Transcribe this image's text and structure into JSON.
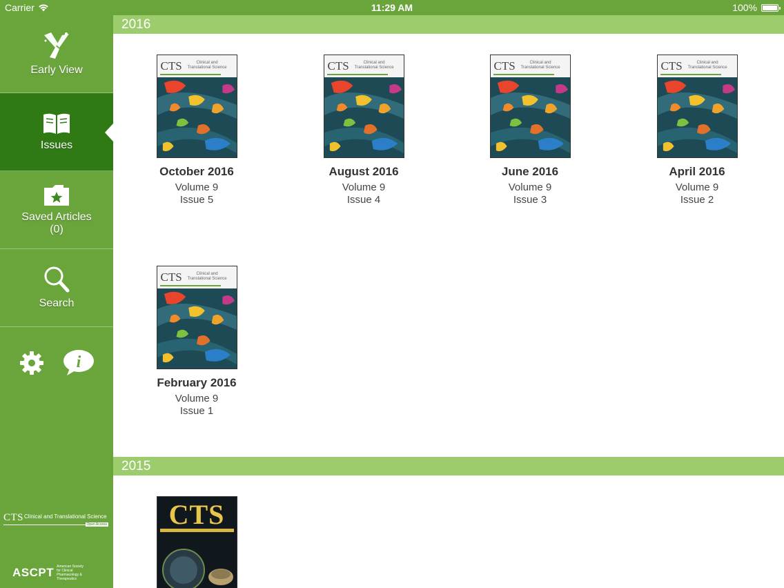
{
  "status_bar": {
    "carrier": "Carrier",
    "time": "11:29 AM",
    "battery": "100%"
  },
  "sidebar": {
    "items": [
      {
        "label": "Early View",
        "icon": "early-view-icon"
      },
      {
        "label": "Issues",
        "icon": "book-icon",
        "active": true
      },
      {
        "label": "Saved Articles",
        "count": "(0)",
        "icon": "folder-star-icon"
      },
      {
        "label": "Search",
        "icon": "search-icon"
      }
    ],
    "tools": [
      {
        "icon": "gear-icon"
      },
      {
        "icon": "info-icon"
      }
    ],
    "logos": {
      "cts_mark": "CTS",
      "cts_text": "Clinical and Translational Science",
      "oa_text": "Open Access",
      "ascpt_mark": "ASCPT",
      "ascpt_sub": "American Society for Clinical Pharmacology & Therapeutics"
    }
  },
  "colors": {
    "sidebar_green": "#6aa53c",
    "active_green": "#2f7a14",
    "year_header": "#9ccc6c"
  },
  "sections": [
    {
      "year": "2016",
      "issues": [
        {
          "title": "October 2016",
          "volume": "Volume 9",
          "issue": "Issue 5"
        },
        {
          "title": "August 2016",
          "volume": "Volume 9",
          "issue": "Issue 4"
        },
        {
          "title": "June 2016",
          "volume": "Volume 9",
          "issue": "Issue 3"
        },
        {
          "title": "April 2016",
          "volume": "Volume 9",
          "issue": "Issue 2"
        },
        {
          "title": "February 2016",
          "volume": "Volume 9",
          "issue": "Issue 1"
        }
      ]
    },
    {
      "year": "2015",
      "issues": [
        {
          "cover_title": "CTS"
        }
      ]
    }
  ],
  "cover": {
    "title": "CTS",
    "subtitle_line1": "Clinical and",
    "subtitle_line2": "Translational Science"
  }
}
